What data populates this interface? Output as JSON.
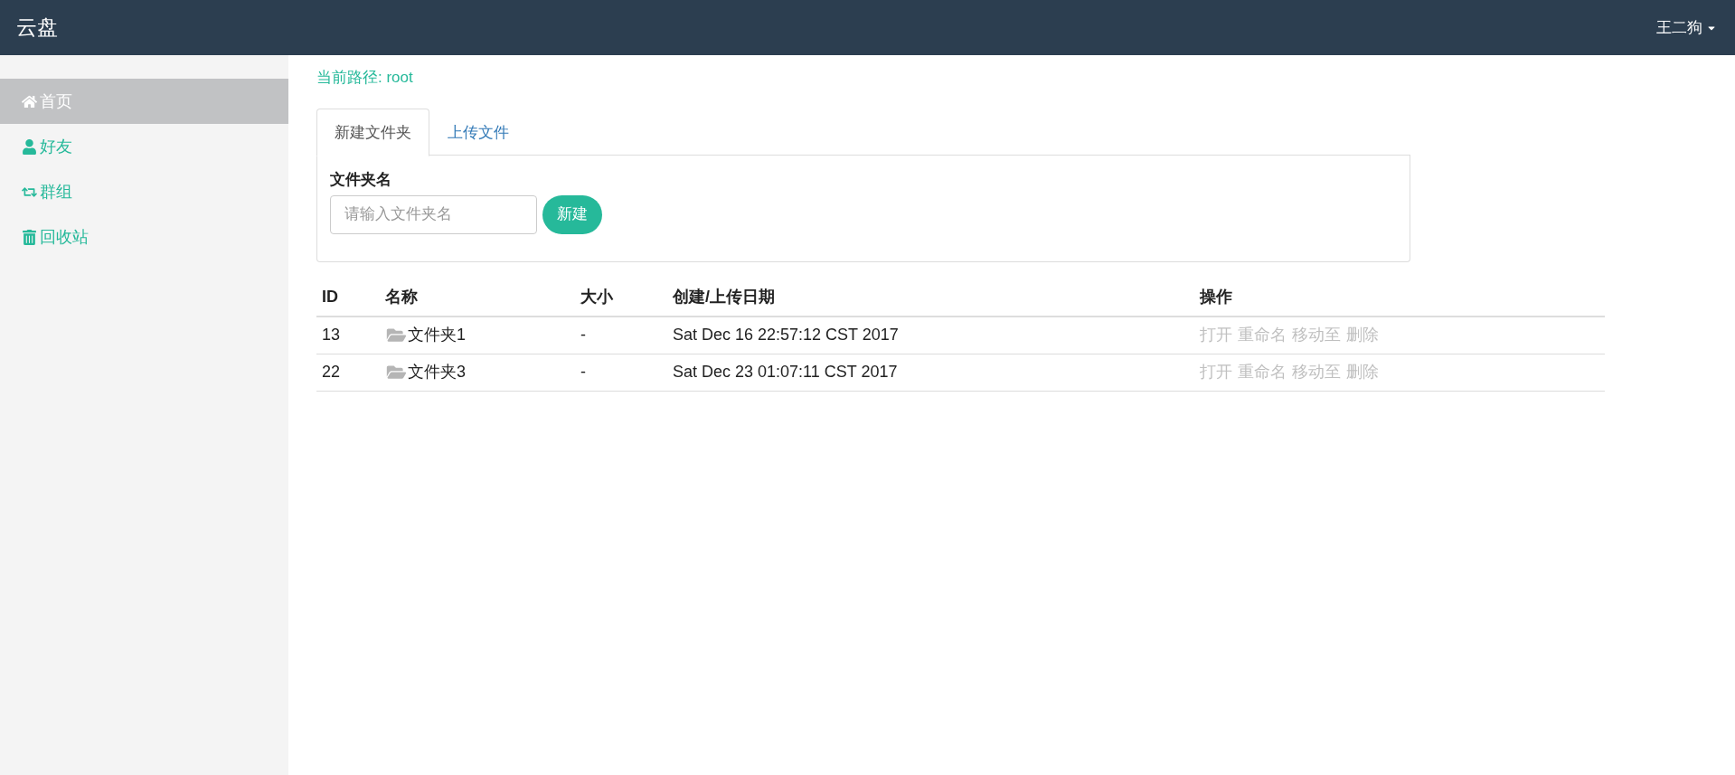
{
  "navbar": {
    "brand": "云盘",
    "user": "王二狗"
  },
  "sidebar": {
    "items": [
      {
        "label": "首页",
        "selected": true
      },
      {
        "label": "好友",
        "selected": false
      },
      {
        "label": "群组",
        "selected": false
      },
      {
        "label": "回收站",
        "selected": false
      }
    ]
  },
  "path": "当前路径: root",
  "tabs": [
    {
      "label": "新建文件夹",
      "selected": true
    },
    {
      "label": "上传文件",
      "selected": false
    }
  ],
  "form": {
    "label": "文件夹名",
    "placeholder": "请输入文件夹名",
    "button": "新建"
  },
  "table": {
    "columns": [
      "ID",
      "名称",
      "大小",
      "创建/上传日期",
      "操作"
    ],
    "rows": [
      {
        "id": "13",
        "name": "文件夹1",
        "size": "-",
        "date": "Sat Dec 16 22:57:12 CST 2017",
        "actions": [
          "打开",
          "重命名",
          "移动至",
          "删除"
        ]
      },
      {
        "id": "22",
        "name": "文件夹3",
        "size": "-",
        "date": "Sat Dec 23 01:07:11 CST 2017",
        "actions": [
          "打开",
          "重命名",
          "移动至",
          "删除"
        ]
      }
    ]
  }
}
